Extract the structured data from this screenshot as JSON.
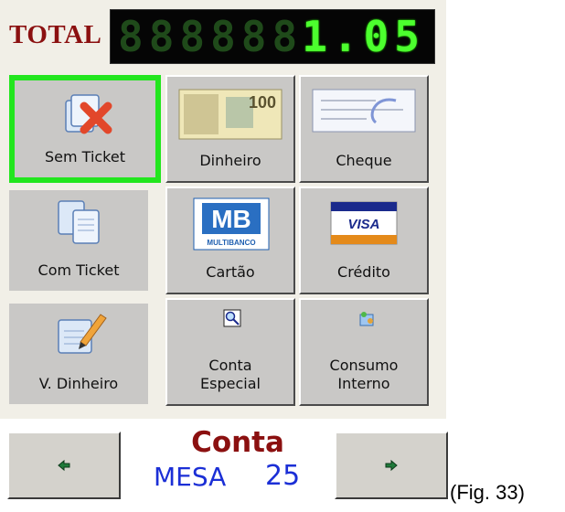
{
  "total": {
    "label": "TOTAL",
    "ghost_digits": "88888888",
    "value": "1.05"
  },
  "buttons": [
    {
      "id": "sem-ticket",
      "label": "Sem Ticket"
    },
    {
      "id": "dinheiro",
      "label": "Dinheiro"
    },
    {
      "id": "cheque",
      "label": "Cheque"
    },
    {
      "id": "com-ticket",
      "label": "Com Ticket"
    },
    {
      "id": "cartao",
      "label": "Cartão"
    },
    {
      "id": "credito",
      "label": "Crédito"
    },
    {
      "id": "v-dinheiro",
      "label": "V. Dinheiro"
    },
    {
      "id": "conta-especial",
      "label": "Conta Especial"
    },
    {
      "id": "consumo-interno",
      "label": "Consumo Interno"
    }
  ],
  "icons": {
    "banknote_text": "100",
    "mb_text": "MB",
    "multibanco_text": "MULTIBANCO",
    "visa_text": "VISA"
  },
  "colors": {
    "accent_green": "#22e61e",
    "display_green": "#4cff2e",
    "brand_red": "#8b1010",
    "blue": "#1b2fd6"
  },
  "footer": {
    "conta": "Conta",
    "mesa_label": "MESA",
    "mesa_number": "25",
    "prev_icon": "arrow-left-icon",
    "next_icon": "arrow-right-icon"
  },
  "caption": "(Fig. 33)"
}
